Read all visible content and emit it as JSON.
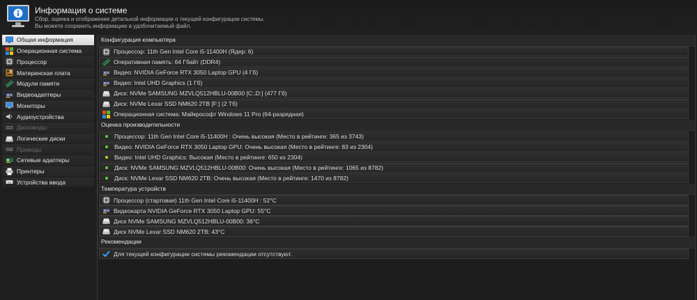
{
  "header": {
    "title": "Информация о системе",
    "subtitle_line1": "Сбор, оценка и отображение детальной информации о текущей конфигурации системы.",
    "subtitle_line2": "Вы можете сохранить информацию в удобочитаемый файл."
  },
  "sidebar": {
    "items": [
      {
        "label": "Общая информация",
        "icon": "monitor-info-icon"
      },
      {
        "label": "Операционная система",
        "icon": "windows-logo-icon"
      },
      {
        "label": "Процессор",
        "icon": "cpu-icon"
      },
      {
        "label": "Материнская плата",
        "icon": "motherboard-icon"
      },
      {
        "label": "Модули памяти",
        "icon": "memory-module-icon"
      },
      {
        "label": "Видеоадаптеры",
        "icon": "video-card-icon"
      },
      {
        "label": "Мониторы",
        "icon": "monitor-icon"
      },
      {
        "label": "Аудиоустройства",
        "icon": "speaker-icon"
      },
      {
        "label": "Дисководы",
        "icon": "floppy-drive-icon"
      },
      {
        "label": "Логические диски",
        "icon": "disk-icon"
      },
      {
        "label": "Приводы",
        "icon": "optical-drive-icon"
      },
      {
        "label": "Сетевые адаптеры",
        "icon": "network-card-icon"
      },
      {
        "label": "Принтеры",
        "icon": "printer-icon"
      },
      {
        "label": "Устройства ввода",
        "icon": "keyboard-icon"
      }
    ]
  },
  "sections": {
    "config": {
      "title": "Конфигурация компьютера",
      "rows": [
        {
          "text": "Процессор: 11th Gen Intel Core i5-11400H  (Ядер: 6)",
          "icon": "cpu-icon"
        },
        {
          "text": "Оперативная память: 64 Гбайт (DDR4)",
          "icon": "memory-module-icon"
        },
        {
          "text": "Видео: NVIDIA GeForce RTX 3050 Laptop GPU (4 Гб)",
          "icon": "video-card-icon"
        },
        {
          "text": "Видео: Intel UHD Graphics (1 Гб)",
          "icon": "video-card-icon"
        },
        {
          "text": "Диск: NVMe SAMSUNG MZVLQ512HBLU-00B00 [C:,D:] (477 Гб)",
          "icon": "disk-icon"
        },
        {
          "text": "Диск: NVMe Lexar SSD NM620 2TB [F:] (2 Тб)",
          "icon": "disk-icon"
        },
        {
          "text": "Операционная система: Майкрософт Windows 11 Pro (64-разрядная)",
          "icon": "windows-logo-icon"
        }
      ]
    },
    "performance": {
      "title": "Оценка производительности",
      "rows": [
        {
          "text": "Процессор: 11th Gen Intel Core i5-11400H : Очень высокая (Место в рейтинге: 365 из 3743)",
          "dot_color": "#5fd03a"
        },
        {
          "text": "Видео: NVIDIA GeForce RTX 3050 Laptop GPU: Очень высокая (Место в рейтинге: 83 из 2304)",
          "dot_color": "#5fd03a"
        },
        {
          "text": "Видео: Intel UHD Graphics: Высокая (Место в рейтинге: 650 из 2304)",
          "dot_color": "#c8d020"
        },
        {
          "text": "Диск: NVMe SAMSUNG MZVLQ512HBLU-00B00: Очень высокая (Место в рейтинге: 1065 из 8782)",
          "dot_color": "#5fd03a"
        },
        {
          "text": "Диск: NVMe Lexar SSD NM620 2TB: Очень высокая (Место в рейтинге: 1470 из 8782)",
          "dot_color": "#5fd03a"
        }
      ]
    },
    "temperature": {
      "title": "Температура устройств",
      "rows": [
        {
          "text": "Процессор (стартовая) 11th Gen Intel Core i5-11400H : 52°C",
          "icon": "cpu-icon"
        },
        {
          "text": "Видеокарта NVIDIA GeForce RTX 3050 Laptop GPU: 55°C",
          "icon": "video-card-icon"
        },
        {
          "text": "Диск NVMe SAMSUNG MZVLQ512HBLU-00B00: 36°C",
          "icon": "disk-icon"
        },
        {
          "text": "Диск NVMe Lexar SSD NM620 2TB: 43°C",
          "icon": "disk-icon"
        }
      ]
    },
    "recommendations": {
      "title": "Рекомендации",
      "rows": [
        {
          "text": "Для текущей конфигурации системы рекомендации отсутствуют.",
          "icon": "checkmark-icon"
        }
      ]
    }
  },
  "colors": {
    "accent_blue": "#3a8ee0",
    "good": "#5fd03a",
    "medium": "#c8d020",
    "check": "#3aa0ff"
  }
}
